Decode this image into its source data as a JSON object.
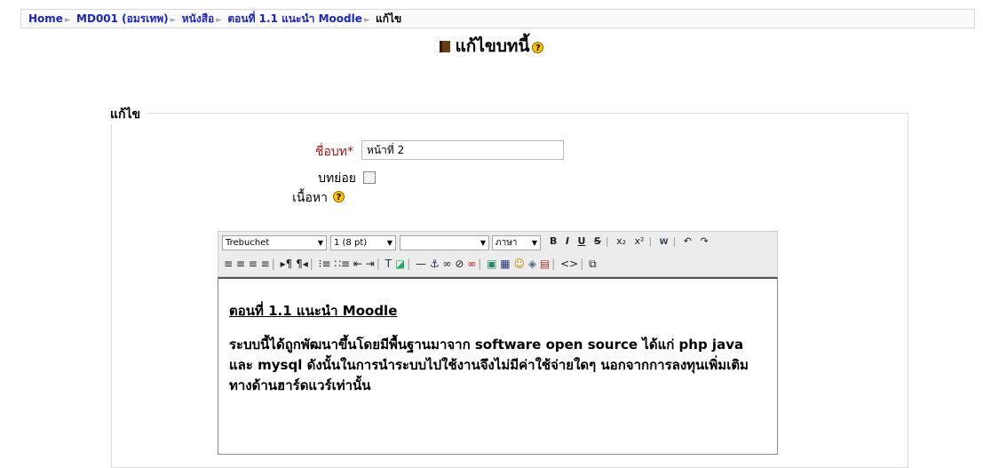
{
  "breadcrumb": {
    "home": "Home",
    "course": "MD001 (อมรเทพ)",
    "book": "หนังสือ",
    "chapter": "ตอนที่ 1.1 แนะนำ Moodle",
    "current": "แก้ไข",
    "separator": "►"
  },
  "page": {
    "title": "แก้ไขบทนี้",
    "help_icon": "?"
  },
  "form": {
    "legend": "แก้ไข",
    "chapter_title_label": "ชื่อบท",
    "required_marker": "*",
    "chapter_title_value": "หน้าที่ 2",
    "subchapter_label": "บทย่อย",
    "subchapter_checked": false,
    "content_label": "เนื้อหา",
    "content_help_icon": "?"
  },
  "editor_toolbar": {
    "font_family": "Trebuchet",
    "font_size": "1 (8 pt)",
    "style": "",
    "language": "ภาษา",
    "row1_icons": [
      "B",
      "I",
      "U",
      "S",
      "x₂",
      "x²",
      "W",
      "↶",
      "↷"
    ],
    "row2_icons": [
      "align-left",
      "align-center",
      "align-right",
      "justify",
      "ltr",
      "rtl",
      "ordered-list",
      "unordered-list",
      "outdent",
      "indent",
      "text-color",
      "bg-color",
      "hr",
      "anchor",
      "link",
      "unlink",
      "nolink",
      "image",
      "table",
      "smiley",
      "special-char",
      "paste",
      "html-source",
      "fullscreen"
    ]
  },
  "editor": {
    "heading": "ตอนที่ 1.1 แนะนำ Moodle",
    "paragraph": "ระบบนี้ได้ถูกพัฒนาขึ้นโดยมีพื้นฐานมาจาก software open source ได้แก่ php java และ mysql ดังนั้นในการนำระบบไปใช้งานจึงไม่มีค่าใช้จ่ายใดๆ นอกจากการลงทุนเพิ่มเติมทางด้านฮาร์ดแวร์เท่านั้น"
  }
}
